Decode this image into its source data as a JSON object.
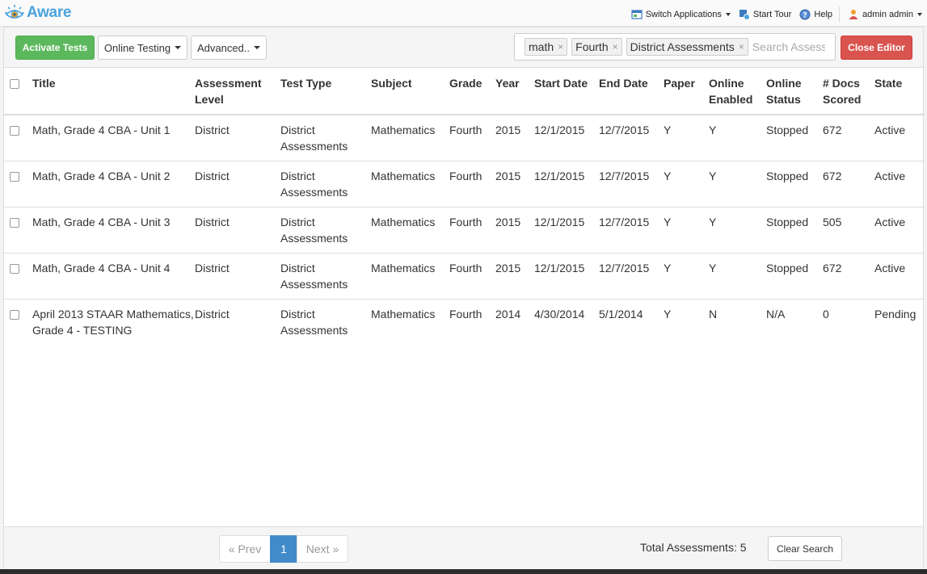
{
  "app": {
    "name": "Aware"
  },
  "topnav": {
    "switch_apps": "Switch Applications",
    "start_tour": "Start Tour",
    "help": "Help",
    "user": "admin admin"
  },
  "toolbar": {
    "activate": "Activate Tests",
    "online_testing": "Online Testing",
    "advanced": "Advanced..",
    "close_editor": "Close Editor",
    "search_placeholder": "Search Assessments",
    "tags": [
      "math",
      "Fourth",
      "District Assessments"
    ]
  },
  "table": {
    "headers": [
      "Title",
      "Assessment Level",
      "Test Type",
      "Subject",
      "Grade",
      "Year",
      "Start Date",
      "End Date",
      "Paper",
      "Online Enabled",
      "Online Status",
      "# Docs Scored",
      "State"
    ],
    "rows": [
      [
        "Math, Grade 4 CBA - Unit 1",
        "District",
        "District Assessments",
        "Mathematics",
        "Fourth",
        "2015",
        "12/1/2015",
        "12/7/2015",
        "Y",
        "Y",
        "Stopped",
        "672",
        "Active"
      ],
      [
        "Math, Grade 4 CBA - Unit 2",
        "District",
        "District Assessments",
        "Mathematics",
        "Fourth",
        "2015",
        "12/1/2015",
        "12/7/2015",
        "Y",
        "Y",
        "Stopped",
        "672",
        "Active"
      ],
      [
        "Math, Grade 4 CBA - Unit 3",
        "District",
        "District Assessments",
        "Mathematics",
        "Fourth",
        "2015",
        "12/1/2015",
        "12/7/2015",
        "Y",
        "Y",
        "Stopped",
        "505",
        "Active"
      ],
      [
        "Math, Grade 4 CBA - Unit 4",
        "District",
        "District Assessments",
        "Mathematics",
        "Fourth",
        "2015",
        "12/1/2015",
        "12/7/2015",
        "Y",
        "Y",
        "Stopped",
        "672",
        "Active"
      ],
      [
        "April 2013 STAAR Mathematics, Grade 4 - TESTING",
        "District",
        "District Assessments",
        "Mathematics",
        "Fourth",
        "2014",
        "4/30/2014",
        "5/1/2014",
        "Y",
        "N",
        "N/A",
        "0",
        "Pending"
      ]
    ]
  },
  "footer": {
    "prev": "« Prev",
    "page": "1",
    "next": "Next »",
    "total": "Total Assessments: 5",
    "clear": "Clear Search"
  }
}
